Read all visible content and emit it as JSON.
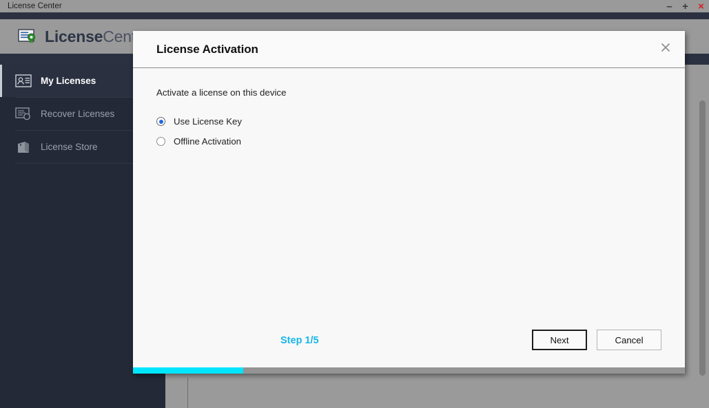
{
  "window": {
    "title": "License Center",
    "controls": [
      {
        "name": "minimize",
        "glyph": "–"
      },
      {
        "name": "maximize",
        "glyph": "+"
      },
      {
        "name": "close",
        "glyph": "×"
      }
    ]
  },
  "app": {
    "brand_bold": "License",
    "brand_light": "Center",
    "logo_icon": "certificate-seal-icon"
  },
  "sidebar": {
    "items": [
      {
        "label": "My Licenses",
        "icon": "id-card-icon",
        "active": true
      },
      {
        "label": "Recover Licenses",
        "icon": "license-recover-icon",
        "active": false
      },
      {
        "label": "License Store",
        "icon": "shopping-bag-icon",
        "active": false
      }
    ]
  },
  "dialog": {
    "title": "License Activation",
    "close_icon": "close-icon",
    "intro": "Activate a license on this device",
    "options": [
      {
        "label": "Use License Key",
        "selected": true
      },
      {
        "label": "Offline Activation",
        "selected": false
      }
    ],
    "step_label": "Step 1/5",
    "progress_percent": 20,
    "buttons": [
      {
        "label": "Next",
        "primary": true
      },
      {
        "label": "Cancel",
        "primary": false
      }
    ]
  },
  "colors": {
    "accent_cyan": "#00e5ff",
    "step_text": "#16b7e8",
    "radio_selected": "#1d6ae0",
    "close_red": "#d81f1f",
    "sidebar_bg": "#232936",
    "header_gray": "#9a9a9a"
  }
}
